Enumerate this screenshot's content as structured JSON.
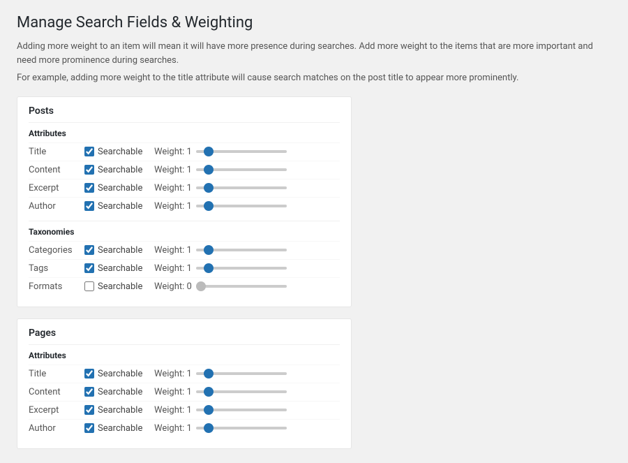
{
  "page": {
    "title": "Manage Search Fields & Weighting",
    "desc1": "Adding more weight to an item will mean it will have more presence during searches. Add more weight to the items that are more important and need more prominence during searches.",
    "desc2": "For example, adding more weight to the title attribute will cause search matches on the post title to appear more prominently."
  },
  "sections": [
    {
      "id": "posts",
      "title": "Posts",
      "groups": [
        {
          "label": "Attributes",
          "items": [
            {
              "name": "Title",
              "searchable": true,
              "weight": 1
            },
            {
              "name": "Content",
              "searchable": true,
              "weight": 1
            },
            {
              "name": "Excerpt",
              "searchable": true,
              "weight": 1
            },
            {
              "name": "Author",
              "searchable": true,
              "weight": 1
            }
          ]
        },
        {
          "label": "Taxonomies",
          "items": [
            {
              "name": "Categories",
              "searchable": true,
              "weight": 1
            },
            {
              "name": "Tags",
              "searchable": true,
              "weight": 1
            },
            {
              "name": "Formats",
              "searchable": false,
              "weight": 0
            }
          ]
        }
      ]
    },
    {
      "id": "pages",
      "title": "Pages",
      "groups": [
        {
          "label": "Attributes",
          "items": [
            {
              "name": "Title",
              "searchable": true,
              "weight": 1
            },
            {
              "name": "Content",
              "searchable": true,
              "weight": 1
            },
            {
              "name": "Excerpt",
              "searchable": true,
              "weight": 1
            },
            {
              "name": "Author",
              "searchable": true,
              "weight": 1
            }
          ]
        }
      ]
    }
  ],
  "labels": {
    "searchable": "Searchable",
    "weight_prefix": "Weight: "
  }
}
